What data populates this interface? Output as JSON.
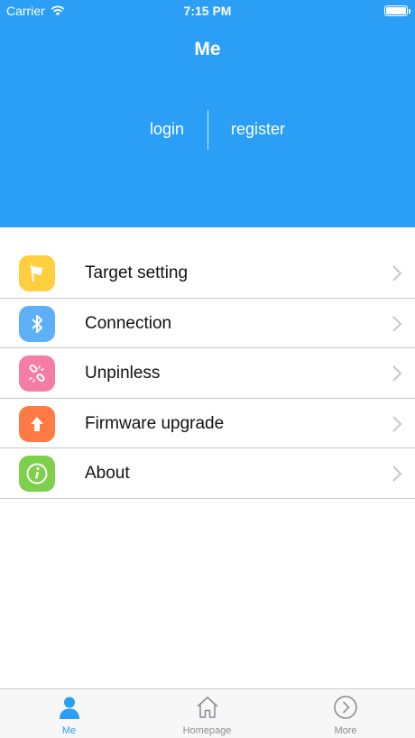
{
  "status_bar": {
    "carrier": "Carrier",
    "time": "7:15 PM"
  },
  "header": {
    "title": "Me",
    "login_label": "login",
    "register_label": "register",
    "background_color": "#2b9ff6"
  },
  "menu": {
    "items": [
      {
        "label": "Target setting",
        "icon": "flag-icon",
        "icon_color": "#ffcf3f"
      },
      {
        "label": "Connection",
        "icon": "bluetooth-icon",
        "icon_color": "#5eb0f6"
      },
      {
        "label": "Unpinless",
        "icon": "unlink-icon",
        "icon_color": "#f47ca5"
      },
      {
        "label": "Firmware upgrade",
        "icon": "upload-arrow-icon",
        "icon_color": "#ff7a45"
      },
      {
        "label": "About",
        "icon": "info-icon",
        "icon_color": "#7ed04a"
      }
    ]
  },
  "tabbar": {
    "tabs": [
      {
        "label": "Me",
        "icon": "person-icon",
        "active": true
      },
      {
        "label": "Homepage",
        "icon": "home-icon",
        "active": false
      },
      {
        "label": "More",
        "icon": "chevron-circle-icon",
        "active": false
      }
    ],
    "active_color": "#2b9ff6"
  }
}
